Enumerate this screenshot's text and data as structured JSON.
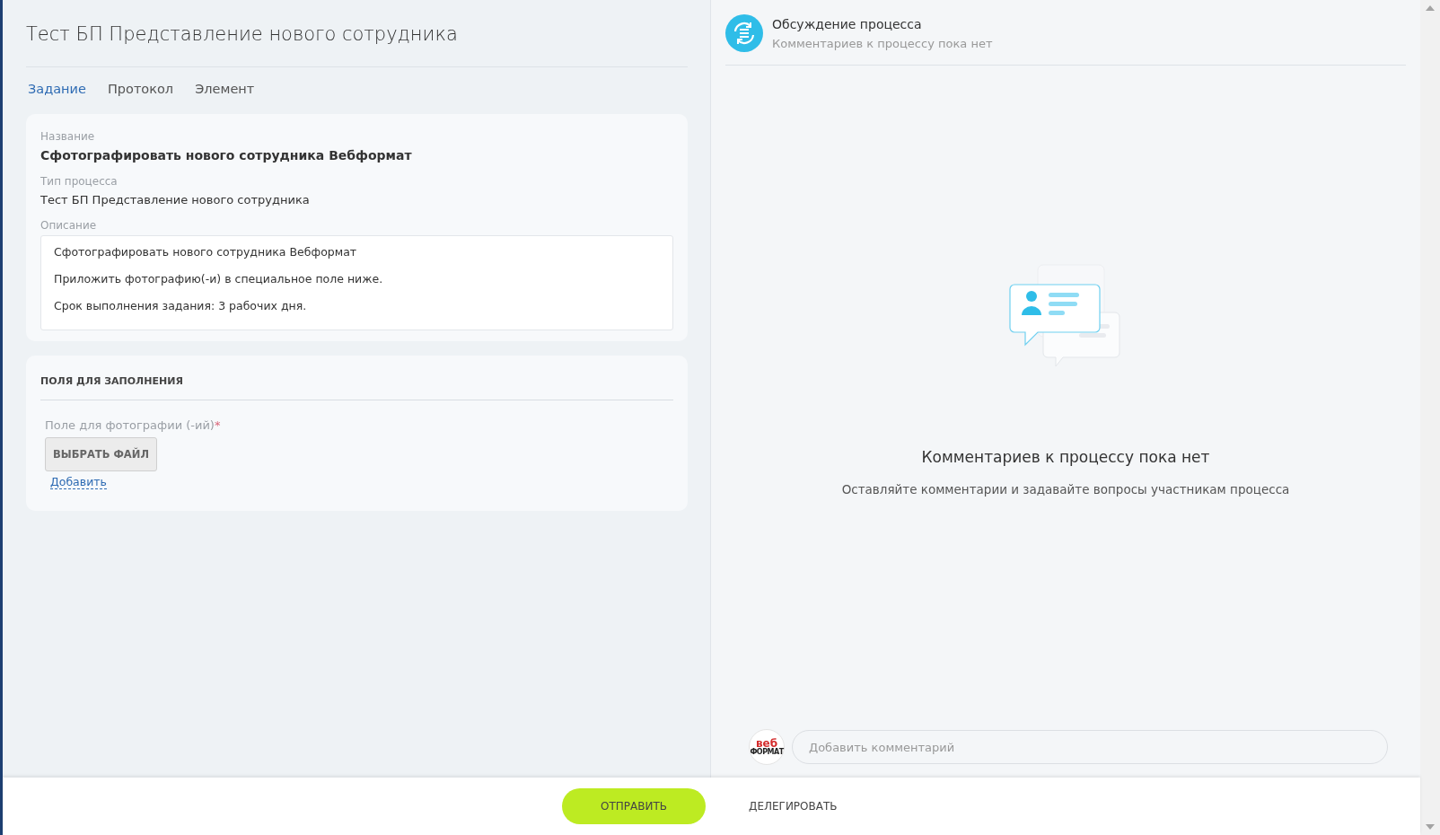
{
  "page_title": "Тест БП Представление нового сотрудника",
  "tabs": [
    {
      "label": "Задание",
      "selected": true
    },
    {
      "label": "Протокол",
      "selected": false
    },
    {
      "label": "Элемент",
      "selected": false
    }
  ],
  "task_card": {
    "name_label": "Название",
    "name_value": "Сфотографировать нового сотрудника Вебформат",
    "process_type_label": "Тип процесса",
    "process_type_value": "Тест БП Представление нового сотрудника",
    "description_label": "Описание",
    "description_lines": [
      "Сфотографировать нового сотрудника Вебформат",
      "Приложить фотографию(-и) в специальное поле ниже.",
      "Срок выполнения задания: 3 рабочих дня."
    ]
  },
  "fields_card": {
    "heading": "ПОЛЯ ДЛЯ ЗАПОЛНЕНИЯ",
    "field_label": "Поле для фотографии (-ий)",
    "required": true,
    "required_mark": "*",
    "file_button": "ВЫБРАТЬ ФАЙЛ",
    "add_link": "Добавить"
  },
  "discussion": {
    "title": "Обсуждение процесса",
    "subtitle": "Комментариев к процессу пока нет",
    "empty_title": "Комментариев к процессу пока нет",
    "empty_text": "Оставляйте комментарии и задавайте вопросы участникам процесса",
    "avatar_logo": {
      "line_1": "веб",
      "line_2": "ФОРМАТ"
    },
    "comment_placeholder": "Добавить комментарий"
  },
  "actions": {
    "send": "ОТПРАВИТЬ",
    "delegate": "ДЕЛЕГИРОВАТЬ"
  }
}
